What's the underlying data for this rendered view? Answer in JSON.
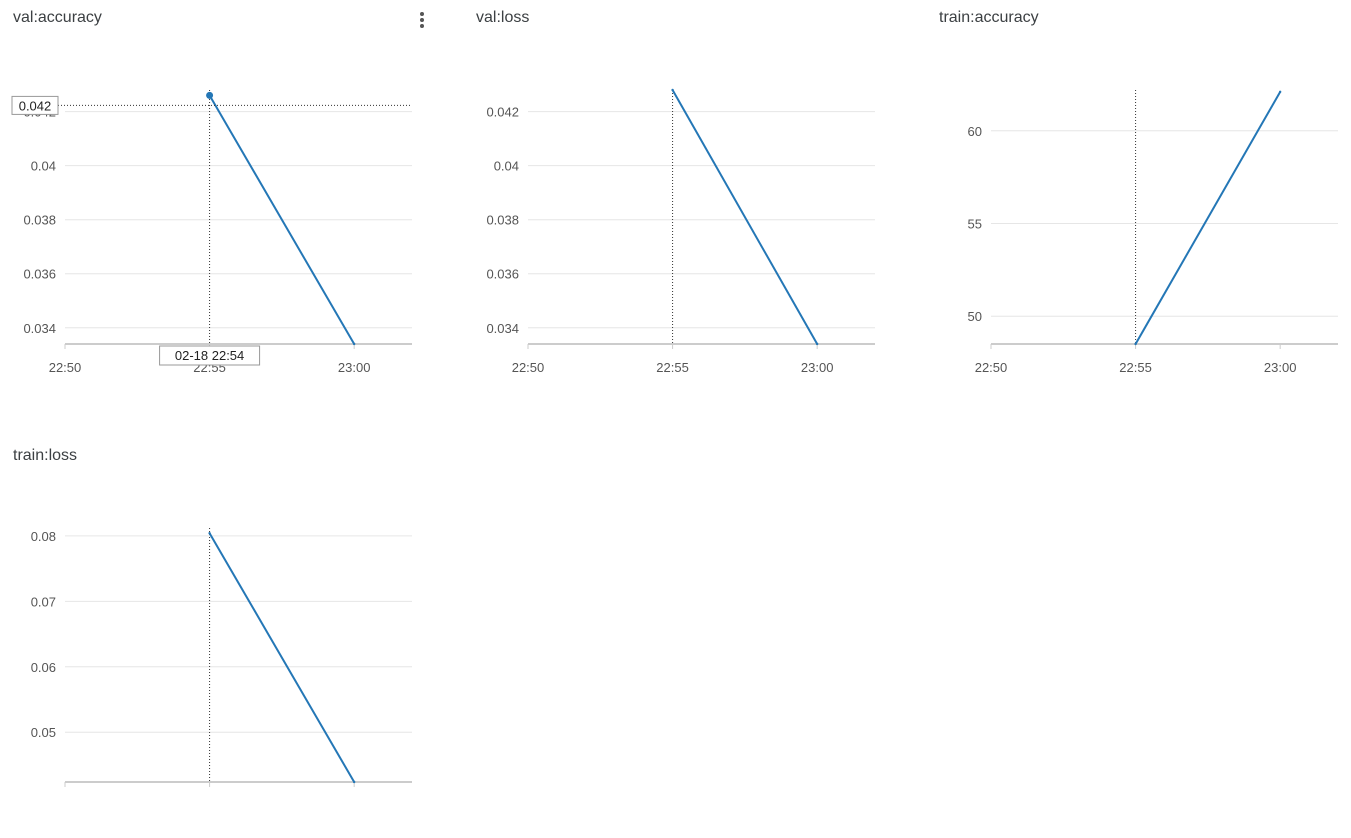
{
  "colors": {
    "line": "#2477b6",
    "grid": "#e6e6e6",
    "axis": "#cccccc",
    "tick_text": "#555555",
    "hover_line": "#333333"
  },
  "panel_menu_icon": "more-vert-icon",
  "hover": {
    "y_value_label": "0.042",
    "x_value_label": "02-18 22:54"
  },
  "chart_data": [
    {
      "type": "line",
      "title": "val:accuracy",
      "x_type": "time",
      "x": [
        "22:55",
        "23:00"
      ],
      "xticks": [
        "22:50",
        "22:55",
        "23:00"
      ],
      "xlim": [
        "22:50",
        "23:02"
      ],
      "series": [
        {
          "values": [
            0.0426,
            0.0334
          ]
        }
      ],
      "yticks": [
        "0.034",
        "0.036",
        "0.038",
        "0.04",
        "0.042"
      ],
      "ylim": [
        0.0334,
        0.0428
      ],
      "grid": true,
      "hover": true
    },
    {
      "type": "line",
      "title": "val:loss",
      "x_type": "time",
      "x": [
        "22:55",
        "23:00"
      ],
      "xticks": [
        "22:50",
        "22:55",
        "23:00"
      ],
      "xlim": [
        "22:50",
        "23:02"
      ],
      "series": [
        {
          "values": [
            0.0428,
            0.0334
          ]
        }
      ],
      "yticks": [
        "0.034",
        "0.036",
        "0.038",
        "0.04",
        "0.042"
      ],
      "ylim": [
        0.0334,
        0.0428
      ],
      "grid": true,
      "hover": false
    },
    {
      "type": "line",
      "title": "train:accuracy",
      "x_type": "time",
      "x": [
        "22:55",
        "23:00"
      ],
      "xticks": [
        "22:50",
        "22:55",
        "23:00"
      ],
      "xlim": [
        "22:50",
        "23:02"
      ],
      "series": [
        {
          "values": [
            48.5,
            62.1
          ]
        }
      ],
      "yticks": [
        "50",
        "55",
        "60"
      ],
      "ylim": [
        48.5,
        62.2
      ],
      "grid": true,
      "hover": false
    },
    {
      "type": "line",
      "title": "train:loss",
      "x_type": "time",
      "x": [
        "22:55",
        "23:00"
      ],
      "xticks": [],
      "xlim": [
        "22:50",
        "23:02"
      ],
      "series": [
        {
          "values": [
            0.0804,
            0.0424
          ]
        }
      ],
      "yticks": [
        "0.05",
        "0.06",
        "0.07",
        "0.08"
      ],
      "ylim": [
        0.0424,
        0.0812
      ],
      "grid": true,
      "hover": false
    }
  ]
}
